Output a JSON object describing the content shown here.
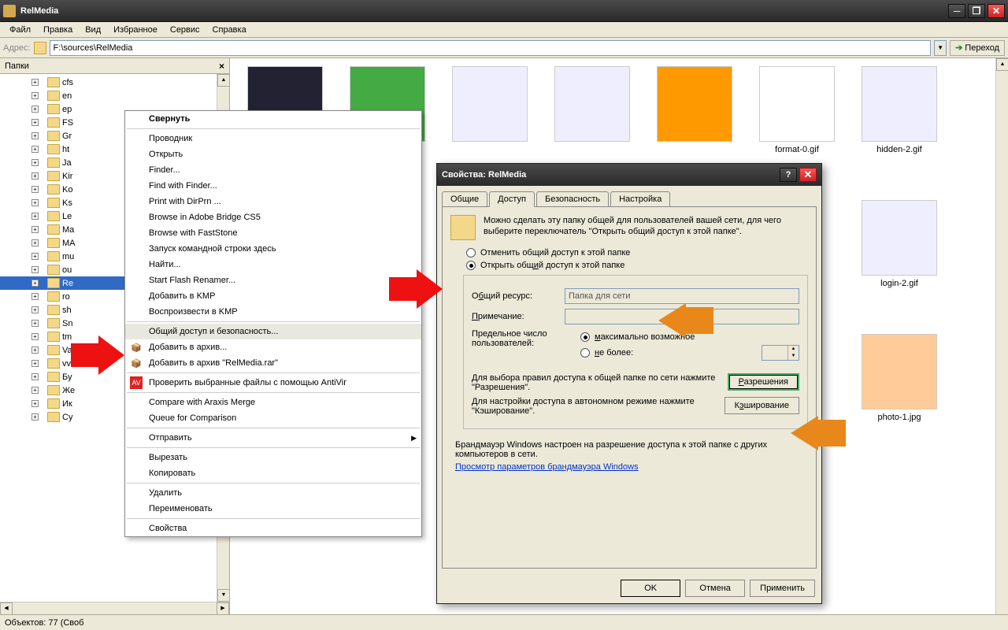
{
  "window": {
    "title": "RelMedia"
  },
  "menubar": [
    "Файл",
    "Правка",
    "Вид",
    "Избранное",
    "Сервис",
    "Справка"
  ],
  "addrbar": {
    "label": "Адрес:",
    "path": "F:\\sources\\RelMedia",
    "go": "Переход"
  },
  "sidebar": {
    "title": "Папки"
  },
  "tree": [
    "cfs",
    "en",
    "ep",
    "FS",
    "Gr",
    "ht",
    "Ja",
    "Kir",
    "Ko",
    "Ks",
    "Le",
    "Ma",
    "MA",
    "mu",
    "ou",
    "Re",
    "ro",
    "sh",
    "Sn",
    "tm",
    "Va",
    "vv",
    "Бу",
    "Же",
    "Ик",
    "Су"
  ],
  "tree_selected": "Re",
  "context_menu": {
    "groups": [
      [
        {
          "label": "Свернуть",
          "bold": true
        }
      ],
      [
        {
          "label": "Проводник"
        },
        {
          "label": "Открыть"
        },
        {
          "label": "Finder..."
        },
        {
          "label": "Find with Finder..."
        },
        {
          "label": "Print with DirPrn ..."
        },
        {
          "label": "Browse in Adobe Bridge CS5"
        },
        {
          "label": "Browse with FastStone"
        },
        {
          "label": "Запуск командной строки здесь"
        },
        {
          "label": "Найти..."
        },
        {
          "label": "Start Flash Renamer..."
        },
        {
          "label": "Добавить в KMP"
        },
        {
          "label": "Воспроизвести в KMP"
        }
      ],
      [
        {
          "label": "Общий доступ и безопасность...",
          "hl": true
        },
        {
          "label": "Добавить в архив...",
          "icon": "archive"
        },
        {
          "label": "Добавить в архив \"RelMedia.rar\"",
          "icon": "archive"
        }
      ],
      [
        {
          "label": "Проверить выбранные файлы с помощью AntiVir",
          "icon": "antivir"
        }
      ],
      [
        {
          "label": "Compare with Araxis Merge"
        },
        {
          "label": "Queue for Comparison"
        }
      ],
      [
        {
          "label": "Отправить",
          "sub": true
        }
      ],
      [
        {
          "label": "Вырезать"
        },
        {
          "label": "Копировать"
        }
      ],
      [
        {
          "label": "Удалить"
        },
        {
          "label": "Переименовать"
        }
      ],
      [
        {
          "label": "Свойства"
        }
      ]
    ]
  },
  "thumbs": [
    {
      "label": "",
      "preview": "dark"
    },
    {
      "label": "",
      "preview": "excel"
    },
    {
      "label": "",
      "preview": "win"
    },
    {
      "label": "",
      "preview": "win"
    },
    {
      "label": "",
      "preview": "files"
    },
    {
      "label": "format-0.gif",
      "preview": "file***"
    },
    {
      "label": "hidden-2.gif",
      "preview": "win"
    },
    {
      "label": "login-2.gif",
      "preview": "win"
    },
    {
      "label": "photo-1.jpg",
      "preview": "photo"
    }
  ],
  "dialog": {
    "title": "Свойства: RelMedia",
    "tabs": [
      "Общие",
      "Доступ",
      "Безопасность",
      "Настройка"
    ],
    "active_tab": "Доступ",
    "desc": "Можно сделать эту папку общей для пользователей вашей сети, для чего выберите переключатель \"Открыть общий доступ к этой папке\".",
    "radio_off": "Отменить общий доступ к этой папке",
    "radio_on": "Открыть общий доступ к этой папке",
    "share_label": "Общий ресурс:",
    "share_value": "Папка для сети",
    "note_label": "Примечание:",
    "limit_label": "Предельное число пользователей:",
    "limit_max": "максимально возможное",
    "limit_nomore": "не более:",
    "perm_desc": "Для выбора правил доступа к общей папке по сети нажмите \"Разрешения\".",
    "perm_btn": "Разрешения",
    "cache_desc": "Для настройки доступа в автономном режиме нажмите \"Кэширование\".",
    "cache_btn": "Кэширование",
    "firewall_text": "Брандмауэр Windows настроен на разрешение доступа к этой папке с других компьютеров в сети.",
    "firewall_link": "Просмотр параметров брандмауэра Windows",
    "ok": "OK",
    "cancel": "Отмена",
    "apply": "Применить"
  },
  "statusbar": "Объектов: 77 (Своб"
}
